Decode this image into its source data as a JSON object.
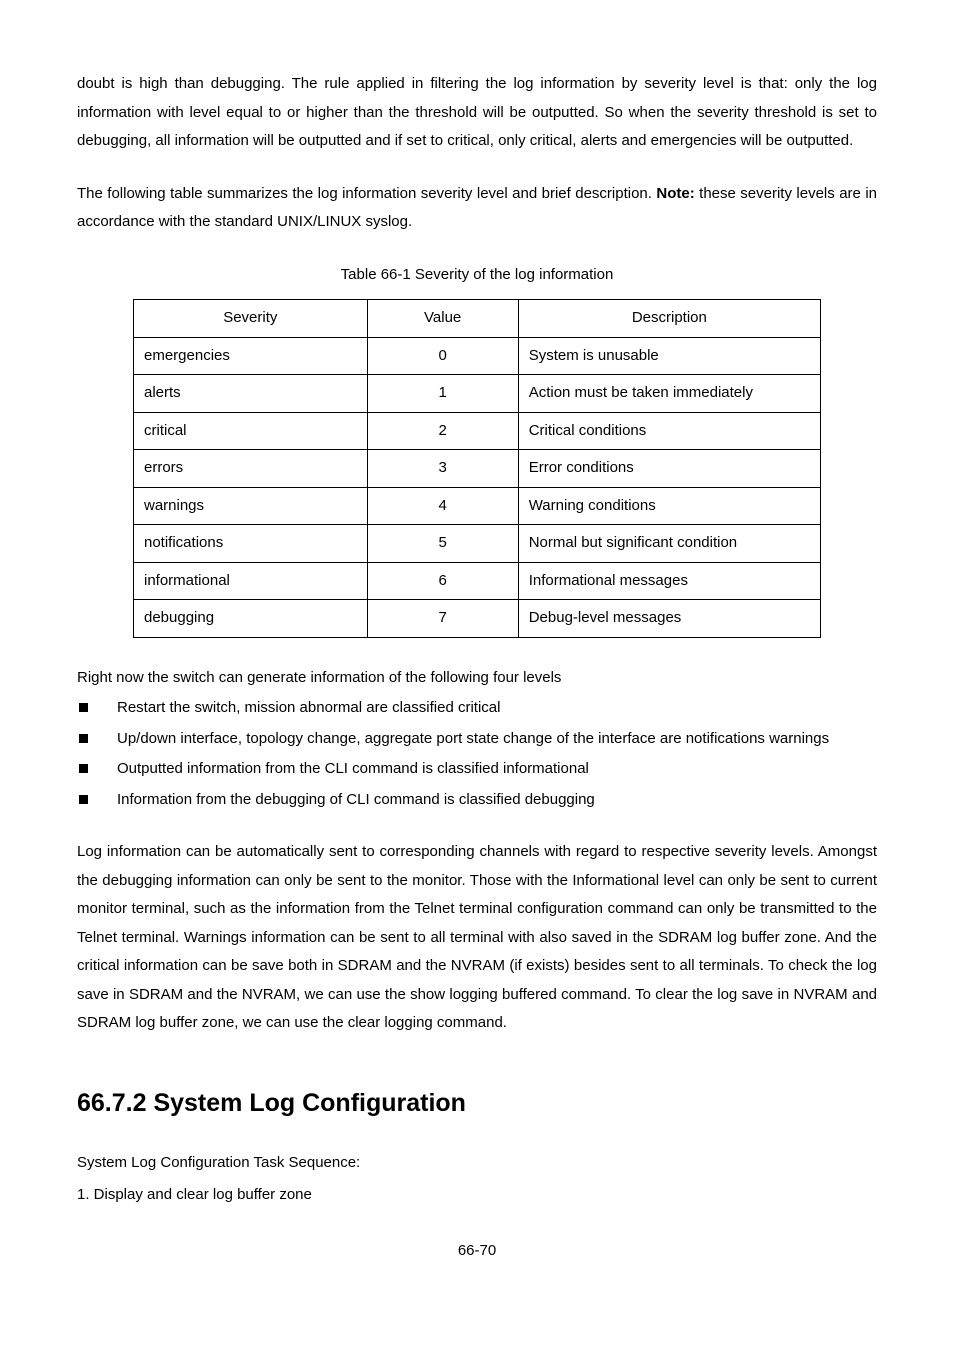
{
  "para1": "doubt is high than debugging. The rule applied in filtering the log information by severity level is that: only the log information with level equal to or higher than the threshold will be outputted. So when the severity threshold is set to debugging, all information will be outputted and if set to critical, only critical, alerts and emergencies will be outputted.",
  "para2_part1": "The following table summarizes the log information severity level and brief description. ",
  "para2_bold": "Note:",
  "para2_part2": " these severity levels are in accordance with the standard UNIX/LINUX syslog.",
  "table_caption": "Table 66-1 Severity of the log   information",
  "table": {
    "headers": [
      "Severity",
      "Value",
      "Description"
    ],
    "rows": [
      [
        "emergencies",
        "0",
        "System is unusable"
      ],
      [
        "alerts",
        "1",
        "Action must be taken immediately"
      ],
      [
        "critical",
        "2",
        "Critical conditions"
      ],
      [
        "errors",
        "3",
        "Error conditions"
      ],
      [
        "warnings",
        "4",
        "Warning conditions"
      ],
      [
        "notifications",
        "5",
        "Normal but significant condition"
      ],
      [
        "informational",
        "6",
        "Informational messages"
      ],
      [
        "debugging",
        "7",
        "Debug-level messages"
      ]
    ]
  },
  "list_intro": "Right now the switch can generate information of the following four levels",
  "list_items": [
    "Restart the switch, mission abnormal are classified critical",
    "Up/down interface, topology change, aggregate port state change of the interface are notifications warnings",
    "Outputted information from the CLI command is classified informational",
    "Information from the debugging of CLI command is classified debugging"
  ],
  "para3": "Log information can be automatically sent to corresponding channels with regard to respective severity levels. Amongst the debugging information can only be sent to the monitor. Those with the Informational level can only be sent to current monitor terminal, such as the information from the Telnet terminal configuration command can only be transmitted to the Telnet terminal. Warnings information can be sent to all terminal with also saved in the SDRAM log buffer zone. And the critical information can be save both in SDRAM and the NVRAM (if exists) besides sent to all terminals. To check the log save in SDRAM and the NVRAM, we can use the show logging buffered command. To clear the log save in NVRAM and SDRAM log buffer zone, we can use the clear logging command.",
  "heading": "66.7.2 System Log Configuration",
  "seq_intro": "System Log Configuration Task Sequence:",
  "seq_item1": "1. Display and clear log buffer zone",
  "page_footer": "66-70"
}
